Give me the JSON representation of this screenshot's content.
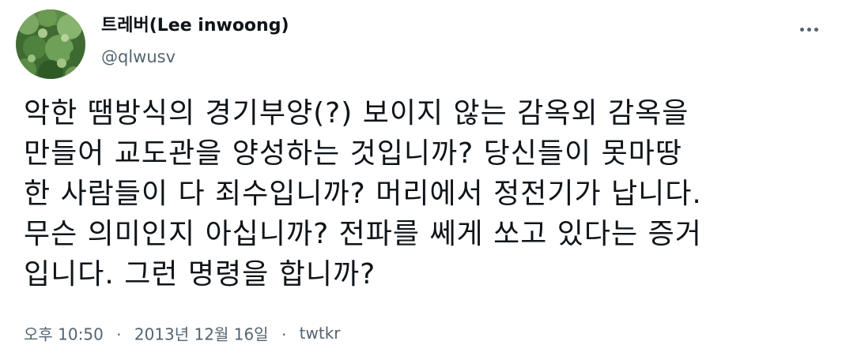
{
  "author": {
    "display_name": "트레버(Lee inwoong)",
    "handle": "@qlwusv"
  },
  "tweet": {
    "lines": [
      "악한 땜방식의 경기부양(?) 보이지 않는 감옥외 감옥을",
      "만들어 교도관을 양성하는 것입니까? 당신들이 못마땅",
      "한 사람들이 다 죄수입니까? 머리에서 정전기가 납니다.",
      "무슨 의미인지 아십니까? 전파를 쎄게 쏘고 있다는 증거",
      "입니다. 그런 명령을 합니까?"
    ]
  },
  "meta": {
    "time": "오후 10:50",
    "separator": "·",
    "date": "2013년 12월 16일",
    "source": "twtkr"
  },
  "icons": {
    "more": "more-horizontal-icon"
  },
  "colors": {
    "text": "#0f1419",
    "secondary": "#536471",
    "avatar_green": "#4a7a3a"
  }
}
